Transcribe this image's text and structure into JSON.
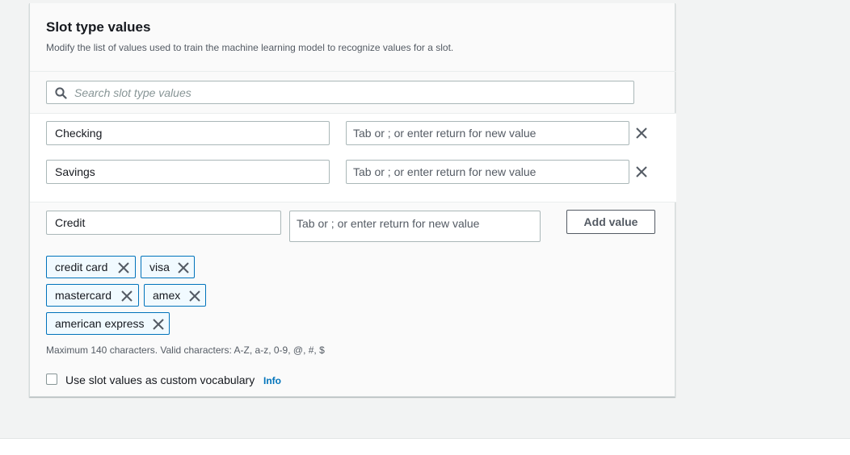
{
  "section": {
    "title": "Slot type values",
    "description": "Modify the list of values used to train the machine learning model to recognize values for a slot."
  },
  "search": {
    "placeholder": "Search slot type values",
    "icon": "search-icon"
  },
  "values": [
    {
      "value": "Checking",
      "synonyms_placeholder": "Tab or ; or enter  return for new value"
    },
    {
      "value": "Savings",
      "synonyms_placeholder": "Tab or ; or enter  return for new value"
    }
  ],
  "new_value": {
    "value": "Credit",
    "synonyms_placeholder": "Tab or ; or enter  return for new value",
    "add_button_label": "Add value",
    "synonyms": [
      "credit card",
      "visa",
      "mastercard",
      "amex",
      "american express"
    ]
  },
  "hint": "Maximum 140 characters. Valid characters: A-Z, a-z, 0-9, @, #, $",
  "custom_vocabulary": {
    "label": "Use slot values as custom vocabulary",
    "checked": false,
    "info_label": "Info"
  },
  "colors": {
    "token_border": "#0073bb",
    "token_bg": "#f1faff",
    "link": "#0073bb"
  }
}
